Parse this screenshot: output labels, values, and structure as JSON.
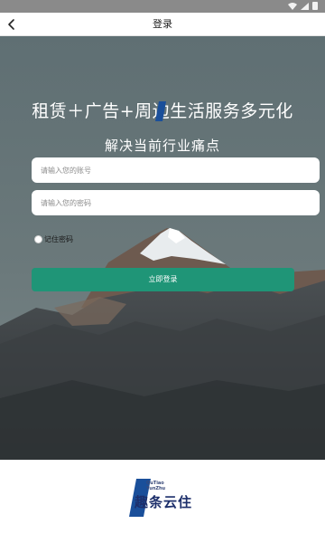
{
  "header": {
    "title": "登录"
  },
  "hero": {
    "slogan": "租赁＋广告+周边生活服务多元化",
    "subslogan": "解决当前行业痛点"
  },
  "form": {
    "account_placeholder": "请输入您的账号",
    "password_placeholder": "请输入您的密码",
    "remember_label": "记住密码",
    "login_label": "立即登录"
  },
  "brand": {
    "logo_text": "趣条云住",
    "logo_small_line1": "QuTiao",
    "logo_small_line2": "YunZhu"
  },
  "colors": {
    "accent": "#1f9577",
    "brand": "#1d2f6b"
  }
}
